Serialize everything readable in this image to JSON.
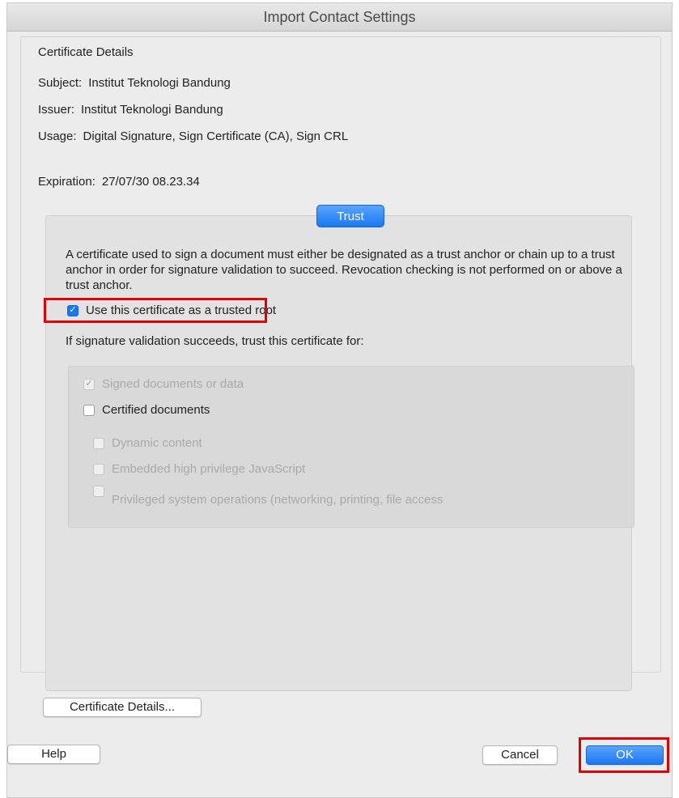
{
  "window": {
    "title": "Import Contact Settings"
  },
  "certificate": {
    "heading": "Certificate Details",
    "subject_label": "Subject:",
    "subject_value": "Institut Teknologi Bandung",
    "issuer_label": "Issuer:",
    "issuer_value": "Institut Teknologi Bandung",
    "usage_label": "Usage:",
    "usage_value": "Digital Signature, Sign Certificate (CA), Sign CRL",
    "expiration_label": "Expiration:",
    "expiration_value": "27/07/30 08.23.34"
  },
  "trust": {
    "tab_label": "Trust",
    "description": "A certificate used to sign a document must either be designated as a trust anchor or chain up to a trust anchor in order for signature validation to succeed.  Revocation checking is not performed on or above a trust anchor.",
    "trusted_root_label": "Use this certificate as a trusted root",
    "trusted_root_checked": true,
    "trust_for_label": "If signature validation succeeds, trust this certificate for:",
    "options": {
      "signed_documents": "Signed documents or data",
      "certified_documents": "Certified documents",
      "dynamic_content": "Dynamic content",
      "embedded_javascript": "Embedded high privilege JavaScript",
      "privileged_operations": "Privileged system operations (networking, printing, file access"
    }
  },
  "buttons": {
    "certificate_details": "Certificate Details...",
    "help": "Help",
    "cancel": "Cancel",
    "ok": "OK"
  },
  "colors": {
    "accent": "#1a78f2",
    "highlight": "#e00000",
    "window_bg": "#ececec"
  }
}
